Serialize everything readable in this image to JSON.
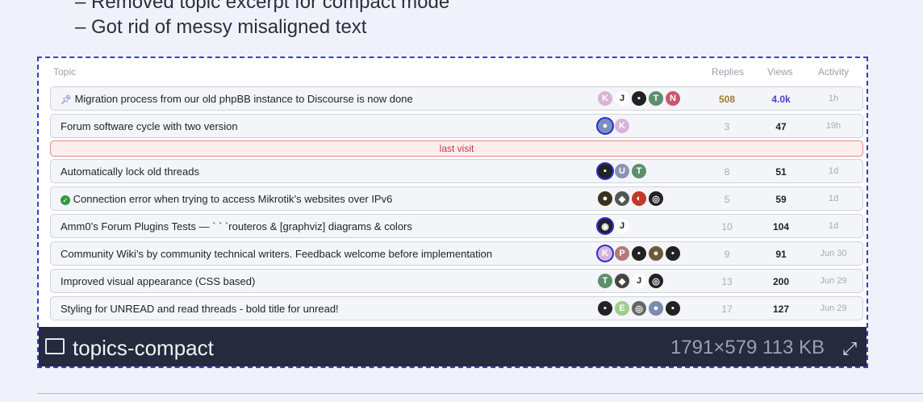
{
  "bullets": [
    "– Removed topic excerpt for compact mode",
    "– Got rid of messy misaligned text"
  ],
  "table": {
    "headers": {
      "topic": "Topic",
      "replies": "Replies",
      "views": "Views",
      "activity": "Activity"
    },
    "last_visit_label": "last visit",
    "rows": [
      {
        "title": "Migration process from our old phpBB instance to Discourse is now done",
        "pinned": true,
        "replies": "508",
        "views": "4.0k",
        "activity": "1h"
      },
      {
        "title": "Forum software cycle with two version",
        "replies": "3",
        "views": "47",
        "activity": "19h"
      },
      {
        "title": "Automatically lock old threads",
        "replies": "8",
        "views": "51",
        "activity": "1d"
      },
      {
        "title": "Connection error when trying to access Mikrotik’s websites over IPv6",
        "solved": true,
        "replies": "5",
        "views": "59",
        "activity": "1d"
      },
      {
        "title": "Amm0’s Forum Plugins Tests — ` ` `routeros & [graphviz] diagrams & colors",
        "replies": "10",
        "views": "104",
        "activity": "1d"
      },
      {
        "title": "Community Wiki’s by community technical writers. Feedback welcome before implementation",
        "replies": "9",
        "views": "91",
        "activity": "Jun 30"
      },
      {
        "title": "Improved visual appearance (CSS based)",
        "replies": "13",
        "views": "200",
        "activity": "Jun 29"
      },
      {
        "title": "Styling for UNREAD and read threads - bold title for unread!",
        "replies": "17",
        "views": "127",
        "activity": "Jun 29"
      }
    ]
  },
  "caption": {
    "filename": "topics-compact",
    "meta": "1791×579 113 KB"
  },
  "colors": {
    "accent": "#3a3ad0",
    "caption_bg": "#252a3c",
    "last_visit": "#c33a3a"
  }
}
